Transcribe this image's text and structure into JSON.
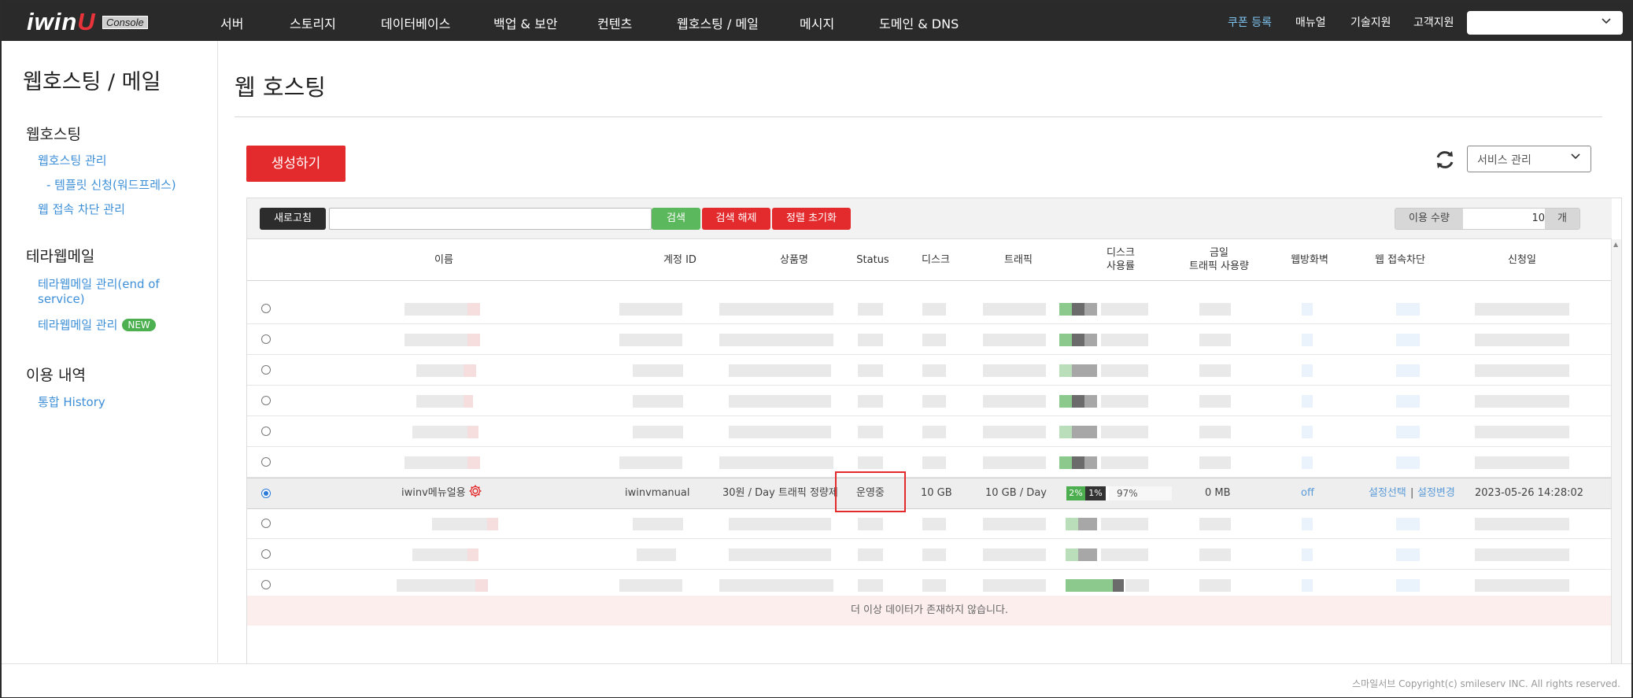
{
  "brand": {
    "logo": "iwin",
    "logo_accent": "U",
    "tag": "Console"
  },
  "nav": {
    "items": [
      "서버",
      "스토리지",
      "데이터베이스",
      "백업 & 보안",
      "컨텐츠",
      "웹호스팅 / 메일",
      "메시지",
      "도메인 & DNS"
    ],
    "util": [
      "쿠폰 등록",
      "매뉴얼",
      "기술지원",
      "고객지원"
    ],
    "select_value": ""
  },
  "sidebar": {
    "title": "웹호스팅 / 메일",
    "sections": [
      {
        "title": "웹호스팅",
        "links": [
          "웹호스팅 관리",
          "- 템플릿 신청(워드프레스)",
          "웹 접속 차단 관리"
        ]
      },
      {
        "title": "테라웹메일",
        "links": [
          "테라웹메일 관리(end of",
          "service)",
          "테라웹메일 관리"
        ],
        "badge": "NEW"
      },
      {
        "title": "이용 내역",
        "links": [
          "통합 History"
        ]
      }
    ]
  },
  "main": {
    "title": "웹 호스팅",
    "create_label": "생성하기",
    "service_select": "서비스 관리",
    "toolbar": {
      "refresh": "새로고침",
      "search_value": "",
      "search": "검색",
      "clear": "검색 해제",
      "reset_sort": "정렬 초기화",
      "qty_label": "이용 수량",
      "qty_value": "10",
      "qty_unit": "개"
    },
    "columns": [
      "이름",
      "계정 ID",
      "상품명",
      "Status",
      "디스크",
      "트래픽",
      "디스크\n사용률",
      "금일\n트래픽 사용량",
      "웹방화벽",
      "웹 접속차단",
      "신청일"
    ],
    "selected_row": {
      "name": "iwinv메뉴얼용",
      "account_id": "iwinvmanual",
      "product": "30원 / Day 트래픽 정량제",
      "status": "운영중",
      "disk": "10 GB",
      "traffic": "10 GB / Day",
      "usage_a": "2%",
      "usage_b": "1%",
      "usage_c": "97%",
      "today_traffic": "0 MB",
      "firewall": "off",
      "block_select": "설정선택",
      "block_sep": "|",
      "block_change": "설정변경",
      "date": "2023-05-26 14:28:02"
    },
    "nodata": "더 이상 데이터가 존재하지 않습니다."
  },
  "footer": {
    "copyright": "스마일서브 Copyright(c) smileserv INC. All rights reserved."
  },
  "colors": {
    "accent_red": "#e32b2d",
    "green": "#4cae4f",
    "nav_bg": "#2a2a2a",
    "link_blue": "#3d8fd7"
  }
}
